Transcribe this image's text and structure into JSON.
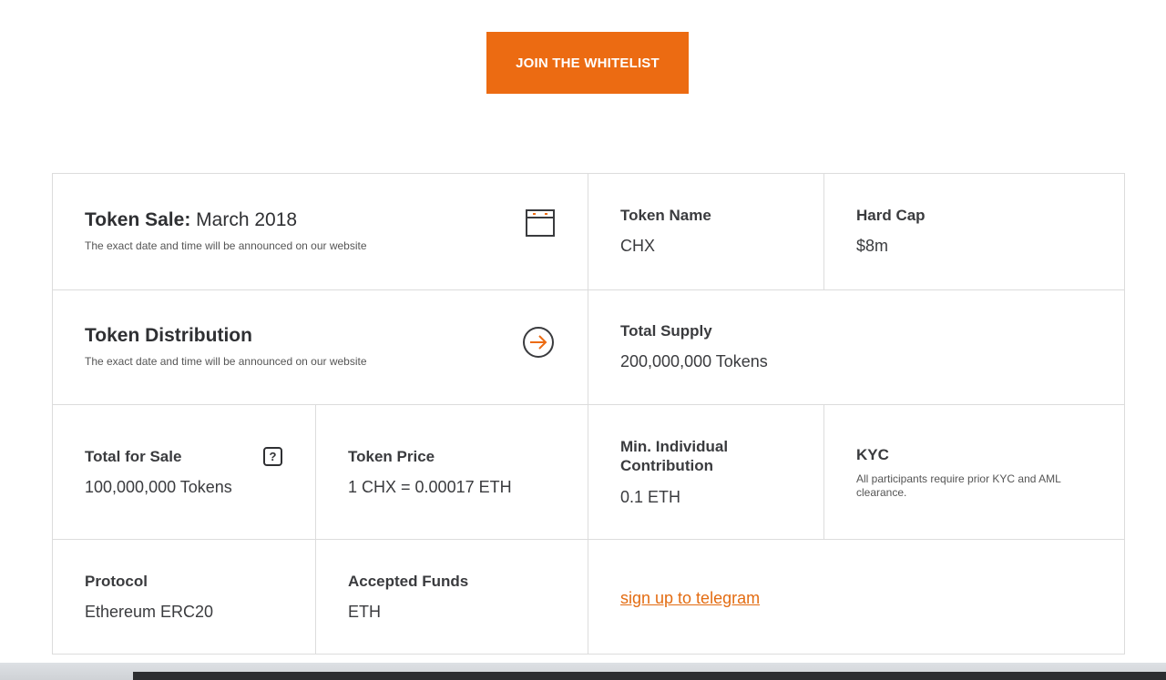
{
  "cta": {
    "label": "JOIN THE WHITELIST"
  },
  "sale": {
    "title_bold": "Token Sale:",
    "title_light": "March 2018",
    "note": "The exact date and time will be announced on our website"
  },
  "token_name": {
    "label": "Token Name",
    "value": "CHX"
  },
  "hard_cap": {
    "label": "Hard Cap",
    "value": "$8m"
  },
  "distribution": {
    "title": "Token Distribution",
    "note": "The exact date and time will be announced on our website"
  },
  "total_supply": {
    "label": "Total Supply",
    "value": "200,000,000 Tokens"
  },
  "total_for_sale": {
    "label": "Total for Sale",
    "value": "100,000,000 Tokens",
    "help_glyph": "?"
  },
  "token_price": {
    "label": "Token Price",
    "value": "1 CHX = 0.00017 ETH"
  },
  "min_contribution": {
    "label_line1": "Min. Individual",
    "label_line2": "Contribution",
    "value": "0.1 ETH"
  },
  "kyc": {
    "label": "KYC",
    "note": "All participants require prior KYC and AML clearance."
  },
  "protocol": {
    "label": "Protocol",
    "value": "Ethereum ERC20"
  },
  "accepted_funds": {
    "label": "Accepted Funds",
    "value": "ETH"
  },
  "telegram": {
    "link": "sign up to telegram"
  },
  "colors": {
    "accent": "#ec6b12",
    "text": "#2f3033",
    "border": "#dcdcdc"
  }
}
